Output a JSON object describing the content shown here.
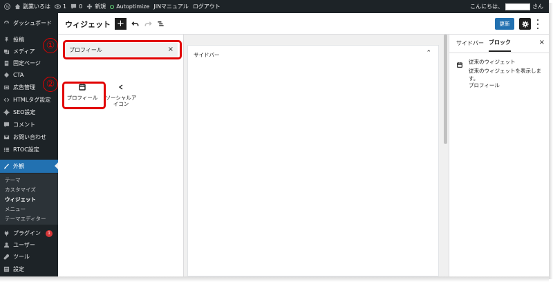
{
  "admin_bar": {
    "site_name": "副業いろは",
    "comments_count": "1",
    "pending_count": "0",
    "new_label": "新規",
    "autoptimize_label": "Autoptimize",
    "manual_label": "JINマニュアル",
    "logout_label": "ログアウト",
    "greeting": "こんにちは、",
    "greeting_suffix": "さん"
  },
  "sidebar": {
    "items": [
      {
        "label": "ダッシュボード",
        "icon": "dashboard-icon"
      },
      {
        "label": "投稿",
        "icon": "pin-icon"
      },
      {
        "label": "メディア",
        "icon": "media-icon"
      },
      {
        "label": "固定ページ",
        "icon": "page-icon"
      },
      {
        "label": "CTA",
        "icon": "tag-icon"
      },
      {
        "label": "広告管理",
        "icon": "ads-icon"
      },
      {
        "label": "HTMLタグ設定",
        "icon": "code-icon"
      },
      {
        "label": "SEO設定",
        "icon": "gear-icon"
      },
      {
        "label": "コメント",
        "icon": "comment-icon"
      },
      {
        "label": "お問い合わせ",
        "icon": "mail-icon"
      },
      {
        "label": "RTOC設定",
        "icon": "list-icon"
      },
      {
        "label": "外観",
        "icon": "brush-icon"
      },
      {
        "label": "プラグイン",
        "icon": "plugin-icon",
        "badge": "1"
      },
      {
        "label": "ユーザー",
        "icon": "user-icon"
      },
      {
        "label": "ツール",
        "icon": "wrench-icon"
      },
      {
        "label": "設定",
        "icon": "settings-icon"
      }
    ],
    "submenu": [
      "テーマ",
      "カスタマイズ",
      "ウィジェット",
      "メニュー",
      "テーマエディター"
    ]
  },
  "header": {
    "title": "ウィジェット",
    "add_label": "+",
    "update_label": "更新"
  },
  "inserter": {
    "search_value": "プロフィール",
    "clear_label": "×",
    "results": [
      {
        "label": "プロフィール",
        "icon": "calendar-icon"
      },
      {
        "label": "ソーシャルア\nイコン",
        "icon": "share-icon"
      }
    ]
  },
  "annotations": {
    "step1": "①",
    "step2": "②"
  },
  "canvas": {
    "widget_area_title": "サイドバー",
    "collapse_label": "⌃"
  },
  "settings": {
    "tab_sidebar": "サイドバー",
    "tab_block": "ブロック",
    "close_label": "×",
    "block_title": "従来のウィジェット",
    "block_description": "従来のウィジェットを表示します。",
    "widget_name": "プロフィール"
  },
  "colors": {
    "admin_dark": "#1d2327",
    "accent_blue": "#2271b1",
    "annotation_red": "#e10000"
  }
}
